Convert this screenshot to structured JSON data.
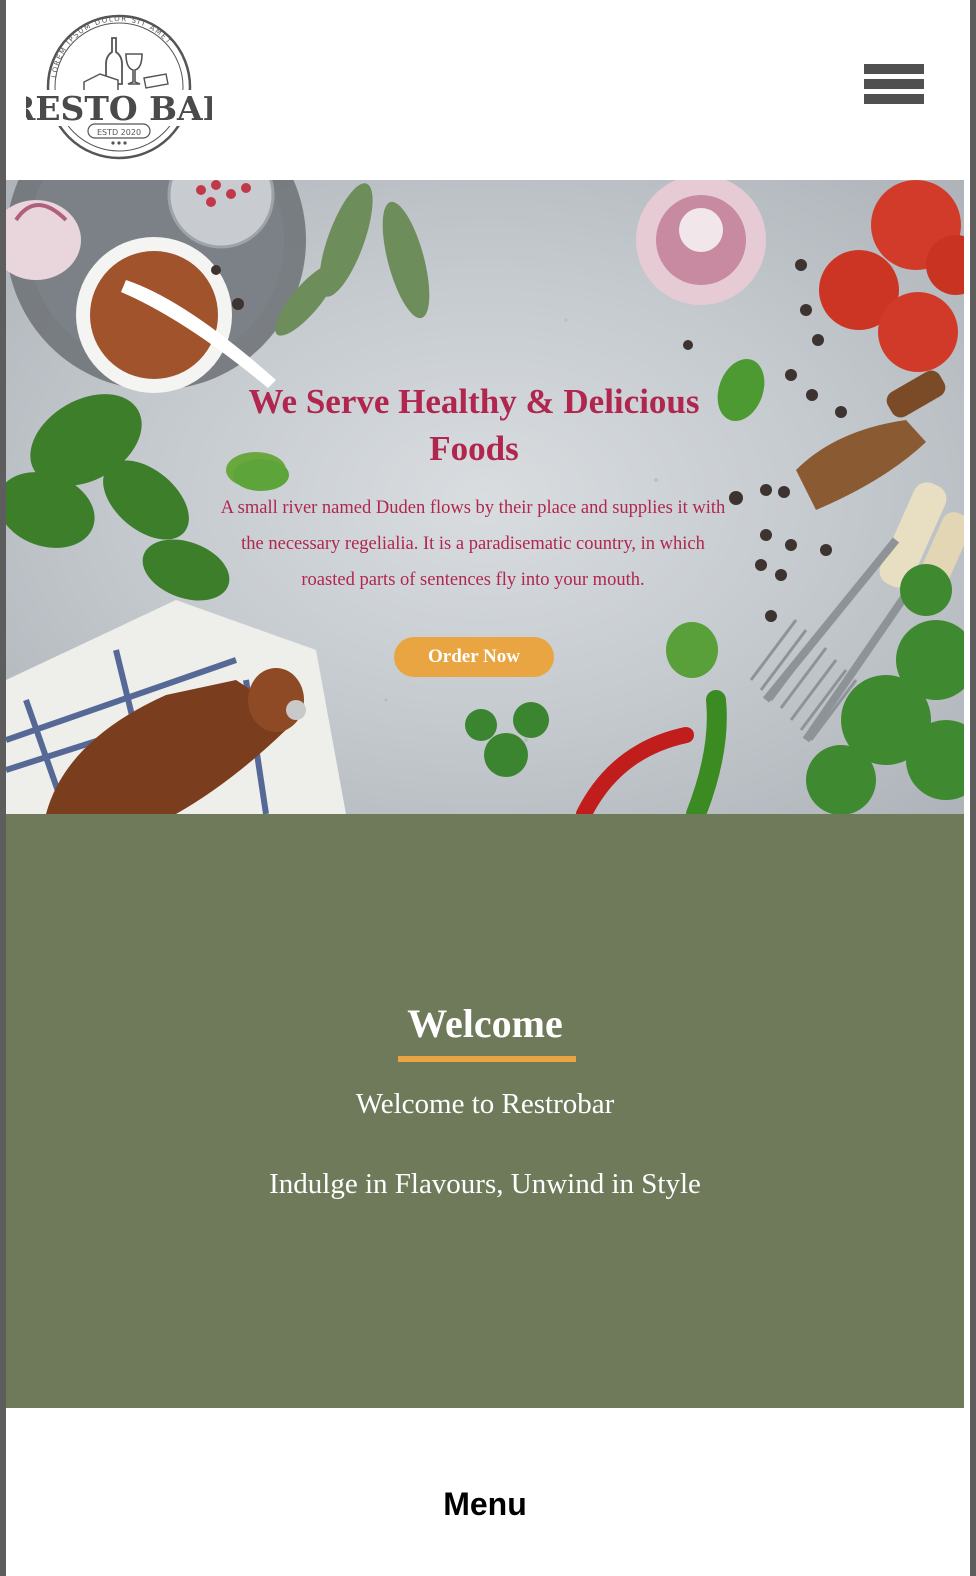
{
  "header": {
    "logo": {
      "name": "RESTO BAR",
      "arc_text": "LOREM IPSUM DOLOR SIT AMET",
      "estd": "ESTD 2020"
    },
    "menu_icon": "hamburger-icon"
  },
  "hero": {
    "title": "We Serve Healthy & Delicious Foods",
    "description": "A small river named Duden flows by their place and supplies it with the necessary regelialia. It is a paradisematic country, in which roasted parts of sentences fly into your mouth.",
    "cta_label": "Order Now"
  },
  "welcome": {
    "title": "Welcome",
    "subtitle": "Welcome to Restrobar",
    "tagline": "Indulge in Flavours, Unwind in Style"
  },
  "menu_section": {
    "title": "Menu"
  },
  "colors": {
    "accent": "#e9a542",
    "hero_text": "#b0264f",
    "welcome_bg": "#6f7a5a",
    "icon_dark": "#505050"
  }
}
